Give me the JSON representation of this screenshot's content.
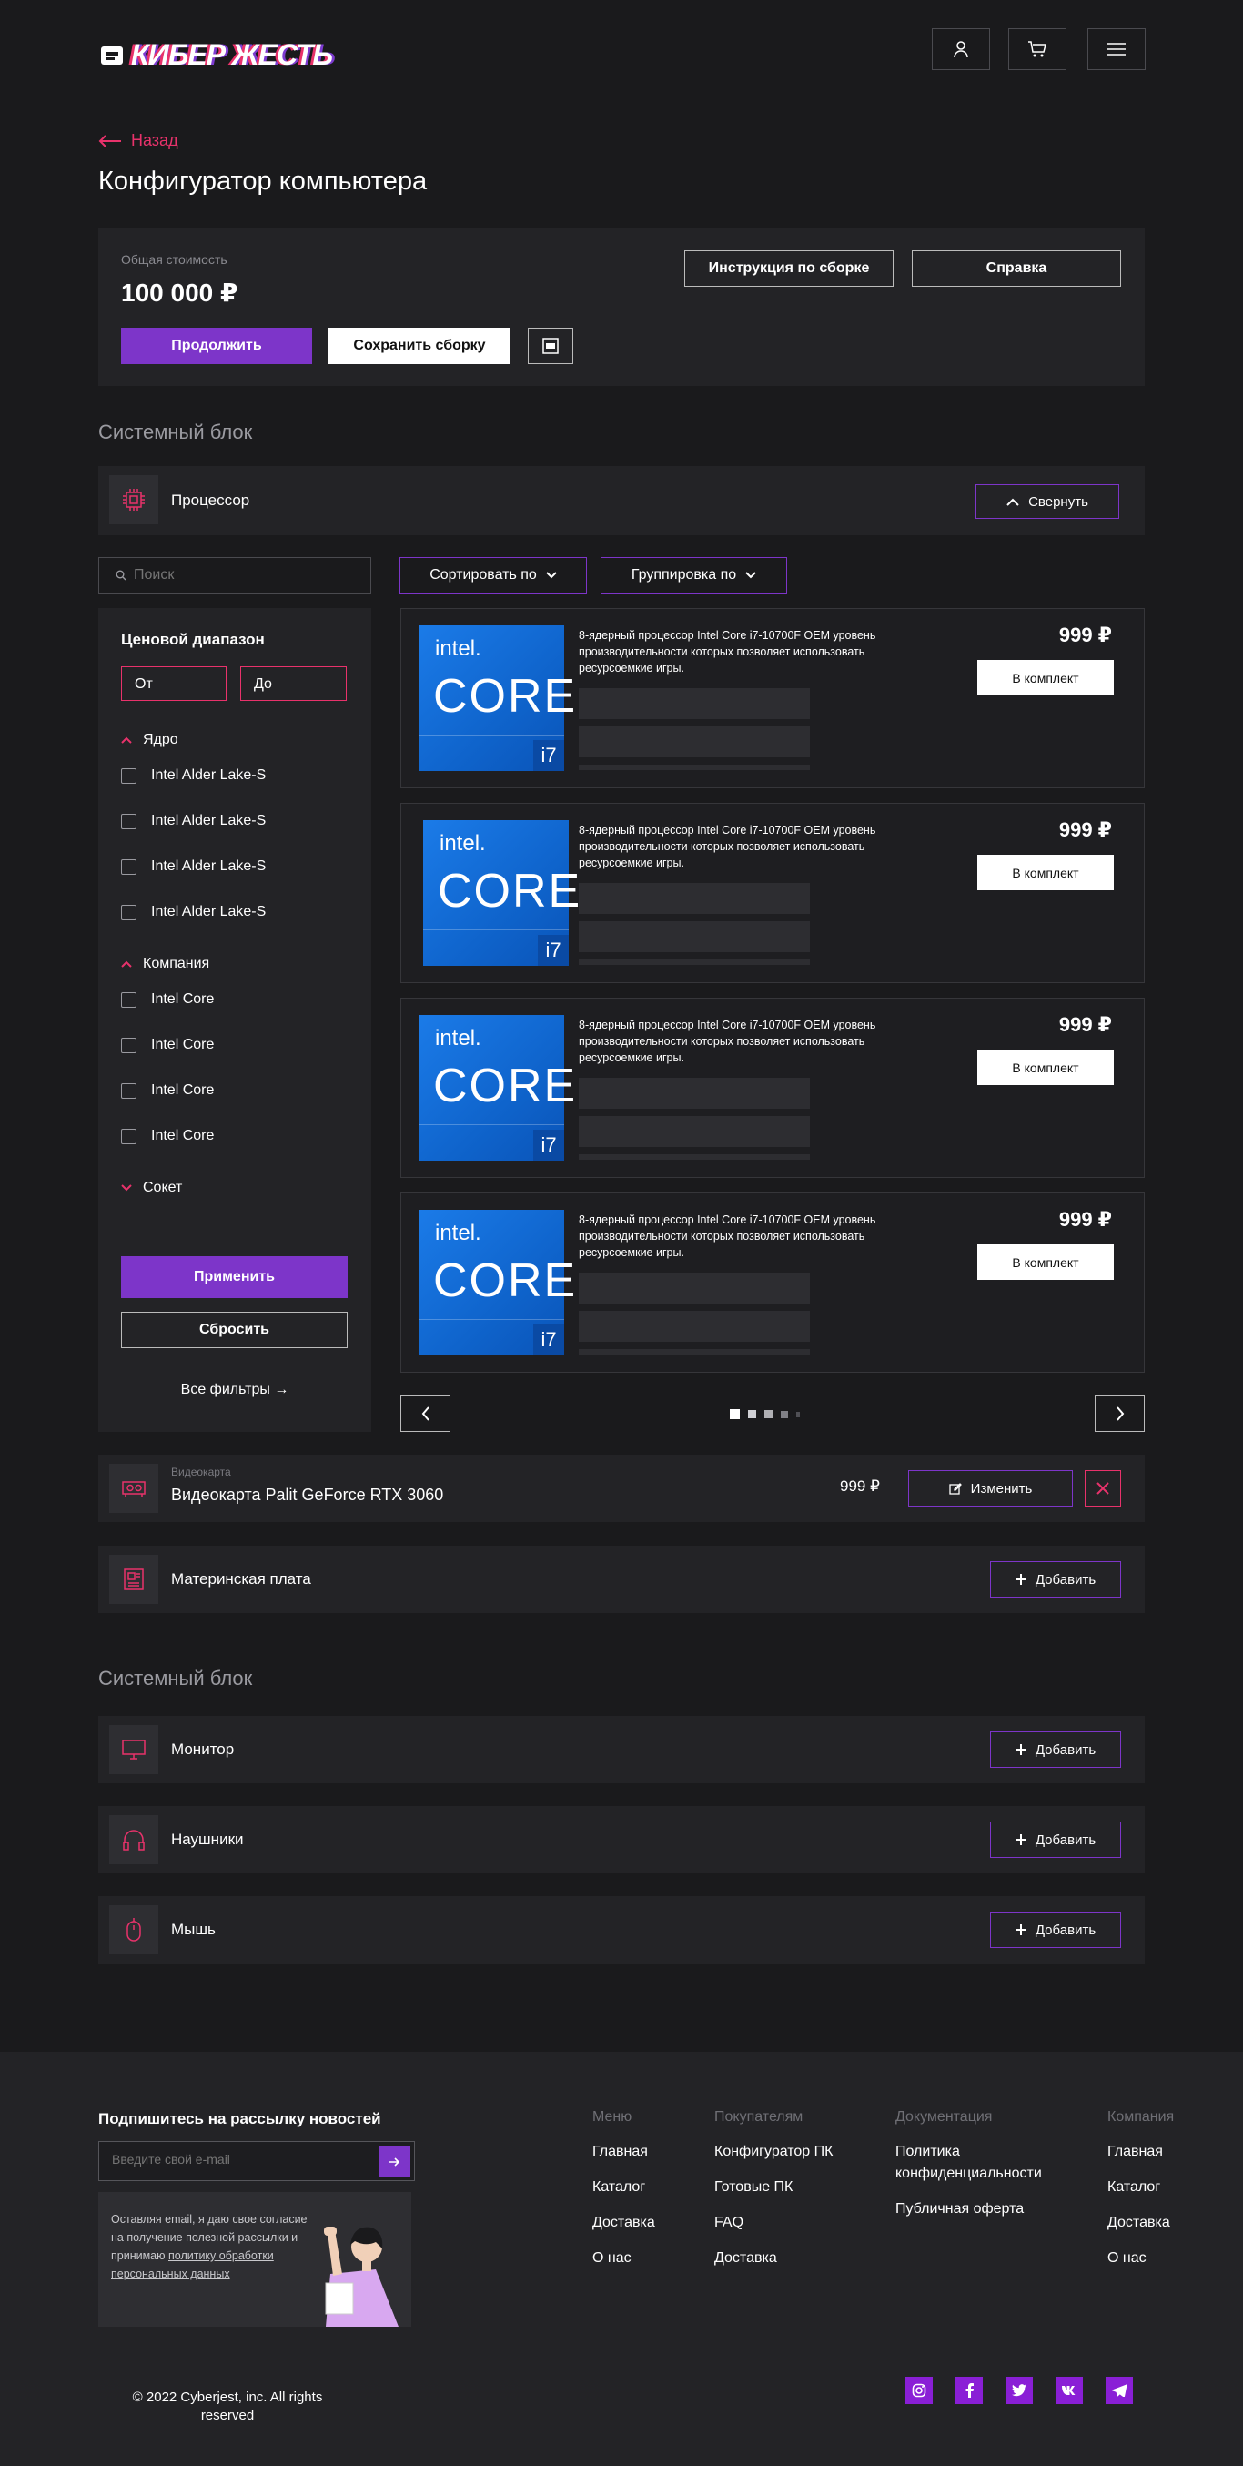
{
  "header": {
    "logo": "КИБЕР ЖЕСТЬ"
  },
  "nav": {
    "back": "Назад",
    "title": "Конфигуратор компьютера"
  },
  "summary": {
    "total_label": "Общая стоимость",
    "total_value": "100 000 ₽",
    "continue": "Продолжить",
    "save": "Сохранить сборку",
    "instruction": "Инструкция по сборке",
    "help": "Справка"
  },
  "section1": {
    "title": "Системный блок"
  },
  "processor": {
    "label": "Процессор",
    "collapse": "Свернуть"
  },
  "filters": {
    "search_placeholder": "Поиск",
    "sort": "Сортировать по",
    "group": "Группировка по",
    "price_range": "Ценовой диапазон",
    "from": "От",
    "to": "До",
    "core_title": "Ядро",
    "core_items": [
      "Intel Alder Lake-S",
      "Intel Alder Lake-S",
      "Intel Alder Lake-S",
      "Intel Alder Lake-S"
    ],
    "company_title": "Компания",
    "company_items": [
      "Intel Core",
      "Intel Core",
      "Intel Core",
      "Intel Core"
    ],
    "socket_title": "Сокет",
    "apply": "Применить",
    "reset": "Сбросить",
    "all_filters": "Все фильтры →"
  },
  "products": [
    {
      "brand": "intel.",
      "line": "CORE",
      "tier": "i7",
      "desc": "8-ядерный процессор Intel Core i7-10700F OEM уровень производительности которых позволяет использовать ресурсоемкие игры.",
      "price": "999 ₽",
      "add": "В комплект"
    },
    {
      "brand": "intel.",
      "line": "CORE",
      "tier": "i7",
      "desc": "8-ядерный процессор Intel Core i7-10700F OEM уровень производительности которых позволяет использовать ресурсоемкие игры.",
      "price": "999 ₽",
      "add": "В комплект"
    },
    {
      "brand": "intel.",
      "line": "CORE",
      "tier": "i7",
      "desc": "8-ядерный процессор Intel Core i7-10700F OEM уровень производительности которых позволяет использовать ресурсоемкие игры.",
      "price": "999 ₽",
      "add": "В комплект"
    },
    {
      "brand": "intel.",
      "line": "CORE",
      "tier": "i7",
      "desc": "8-ядерный процессор Intel Core i7-10700F OEM уровень производительности которых позволяет использовать ресурсоемкие игры.",
      "price": "999 ₽",
      "add": "В комплект"
    }
  ],
  "gpu": {
    "category": "Видеокарта",
    "name": "Видеокарта Palit GeForce RTX 3060",
    "price": "999 ₽",
    "change": "Изменить"
  },
  "motherboard": {
    "label": "Материнская плата",
    "add": "Добавить"
  },
  "section2": {
    "title": "Системный блок"
  },
  "monitor": {
    "label": "Монитор",
    "add": "Добавить"
  },
  "headphones": {
    "label": "Наушники",
    "add": "Добавить"
  },
  "mouse": {
    "label": "Мышь",
    "add": "Добавить"
  },
  "footer": {
    "subscribe_title": "Подпишитесь на рассылку новостей",
    "email_placeholder": "Введите свой e-mail",
    "consent_text": "Оставляя email, я даю свое согласие на получение полезной рассылки и принимаю",
    "consent_link": "политику обработки персональных данных",
    "col1": {
      "title": "Меню",
      "links": [
        "Главная",
        "Каталог",
        "Доставка",
        "О нас"
      ]
    },
    "col2": {
      "title": "Покупателям",
      "links": [
        "Конфигуратор ПК",
        "Готовые ПК",
        "FAQ",
        "Доставка"
      ]
    },
    "col3": {
      "title": "Документация",
      "links": [
        "Политика конфиденциальности",
        "Публичная оферта"
      ]
    },
    "col4": {
      "title": "Компания",
      "links": [
        "Главная",
        "Каталог",
        "Доставка",
        "О нас"
      ]
    },
    "copyright": "© 2022 Cyberjest, inc. All rights reserved"
  },
  "colors": {
    "accent_purple": "#7d35c9",
    "accent_pink": "#e8326b",
    "background": "#1a1a1c",
    "panel": "#232326",
    "social": "#8a1fd6"
  }
}
